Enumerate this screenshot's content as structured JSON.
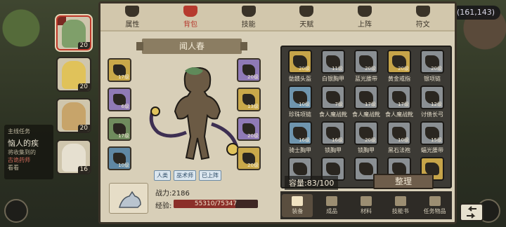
{
  "world": {
    "currency": "(161,143)",
    "quest_header": "主线任务",
    "quest_title": "恼人的疾",
    "quest_lines": [
      "将收集到的",
      "古诡药师",
      "看看"
    ]
  },
  "team": [
    {
      "level": "20",
      "active": true,
      "color": "#7f9f6a"
    },
    {
      "level": "20",
      "active": false,
      "color": "#e0c25a"
    },
    {
      "level": "20",
      "active": false,
      "color": "#c7a46a"
    },
    {
      "level": "16",
      "active": false,
      "color": "#e6e0d0"
    }
  ],
  "tabs": [
    {
      "label": "属性",
      "active": false
    },
    {
      "label": "背包",
      "active": true
    },
    {
      "label": "技能",
      "active": false
    },
    {
      "label": "天赋",
      "active": false
    },
    {
      "label": "上阵",
      "active": false
    },
    {
      "label": "符文",
      "active": false
    }
  ],
  "hero": {
    "name": "闻人春",
    "badges": [
      "人类",
      "巫术师",
      "已上阵"
    ],
    "power_label": "战力:",
    "power_value": "2186",
    "exp_label": "经验:",
    "exp_value": "55310/75347",
    "exp_ratio": 0.734
  },
  "equipped_left": [
    {
      "level": "17级",
      "rarity": "gold"
    },
    {
      "level": "6级",
      "rarity": "purple"
    },
    {
      "level": "17级",
      "rarity": "green"
    },
    {
      "level": "10级",
      "rarity": "blue"
    }
  ],
  "equipped_right": [
    {
      "level": "20级",
      "rarity": "purple"
    },
    {
      "level": "13级",
      "rarity": "gold"
    },
    {
      "level": "20级",
      "rarity": "purple"
    },
    {
      "level": "20级",
      "rarity": "gold"
    }
  ],
  "inventory": {
    "items": [
      {
        "name": "骷髅头盔",
        "level": "20级",
        "rarity": "gold"
      },
      {
        "name": "白银胸甲",
        "level": "11级",
        "rarity": "gray"
      },
      {
        "name": "蓝光腰带",
        "level": "20级",
        "rarity": "gray"
      },
      {
        "name": "黄金戒指",
        "level": "20级",
        "rarity": "gold"
      },
      {
        "name": "银项链",
        "level": "20级",
        "rarity": "gray"
      },
      {
        "name": "珍珠项链",
        "level": "10级",
        "rarity": "blue"
      },
      {
        "name": "食人魔战靴",
        "level": "7级",
        "rarity": "gray"
      },
      {
        "name": "食人魔战靴",
        "level": "17级",
        "rarity": "gray"
      },
      {
        "name": "食人魔战靴",
        "level": "17级",
        "rarity": "gray"
      },
      {
        "name": "讨债长弓",
        "level": "12级",
        "rarity": "gray"
      },
      {
        "name": "骑士胸甲",
        "level": "16级",
        "rarity": "blue"
      },
      {
        "name": "锁胸甲",
        "level": "16级",
        "rarity": "gray"
      },
      {
        "name": "锁胸甲",
        "level": "20级",
        "rarity": "gray"
      },
      {
        "name": "黑石法袍",
        "level": "10级",
        "rarity": "gray"
      },
      {
        "name": "蝠光腰带",
        "level": "15级",
        "rarity": "gray"
      },
      {
        "name": "",
        "level": "",
        "rarity": "gray"
      },
      {
        "name": "",
        "level": "",
        "rarity": "gray"
      },
      {
        "name": "",
        "level": "",
        "rarity": "gray"
      },
      {
        "name": "",
        "level": "",
        "rarity": "gray"
      },
      {
        "name": "",
        "level": "",
        "rarity": "gold"
      }
    ],
    "capacity_label": "容量:",
    "capacity_value": "83/100",
    "sort_label": "整理"
  },
  "bottom_tabs": [
    {
      "label": "装备",
      "active": true
    },
    {
      "label": "成品",
      "active": false
    },
    {
      "label": "材料",
      "active": false
    },
    {
      "label": "技能书",
      "active": false
    },
    {
      "label": "任务物品",
      "active": false
    }
  ]
}
